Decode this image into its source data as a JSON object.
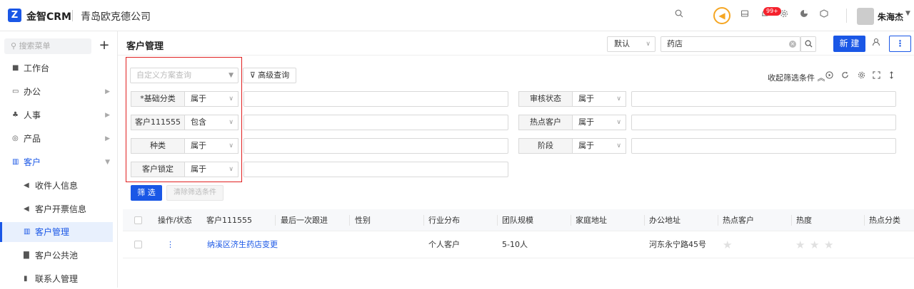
{
  "topbar": {
    "logo_letter": "Z",
    "brand": "金智CRM",
    "company": "青岛欧克德公司",
    "icons": [
      "search-icon",
      "megaphone-icon",
      "inbox-icon",
      "bell-icon",
      "gear-icon",
      "pie-chart-icon",
      "cube-icon"
    ],
    "notification_badge": "99+",
    "username": "朱海杰"
  },
  "sidebar": {
    "search_placeholder": "搜索菜单",
    "add_glyph": "+",
    "items": [
      {
        "label": "工作台",
        "icon": "dashboard-icon",
        "has_arrow": false
      },
      {
        "label": "办公",
        "icon": "monitor-icon",
        "has_arrow": true
      },
      {
        "label": "人事",
        "icon": "org-icon",
        "has_arrow": true
      },
      {
        "label": "产品",
        "icon": "product-icon",
        "has_arrow": true
      },
      {
        "label": "客户",
        "icon": "chart-icon",
        "has_arrow": true,
        "open": true
      }
    ],
    "sub_items": [
      {
        "label": "收件人信息",
        "icon": "speaker-icon"
      },
      {
        "label": "客户开票信息",
        "icon": "speaker-icon"
      },
      {
        "label": "客户管理",
        "icon": "chart-icon",
        "active": true
      },
      {
        "label": "客户公共池",
        "icon": "building-icon"
      },
      {
        "label": "联系人管理",
        "icon": "contact-icon"
      }
    ]
  },
  "header": {
    "title": "客户管理",
    "view_select": "默认",
    "search_value": "药店",
    "new_button": "新 建",
    "more_glyph": "⋮"
  },
  "filter": {
    "scheme_placeholder": "自定义方案查询",
    "advanced_button": "高级查询",
    "collapse_link": "收起筛选条件",
    "rows_left": [
      {
        "label": "*基础分类",
        "op": "属于"
      },
      {
        "label": "客户111555",
        "op": "包含"
      },
      {
        "label": "种类",
        "op": "属于"
      },
      {
        "label": "客户锁定",
        "op": "属于"
      }
    ],
    "rows_right": [
      {
        "label": "审核状态",
        "op": "属于"
      },
      {
        "label": "热点客户",
        "op": "属于"
      },
      {
        "label": "阶段",
        "op": "属于"
      }
    ],
    "filter_button": "筛 选",
    "clear_button": "清除筛选条件"
  },
  "table": {
    "columns": [
      "操作/状态",
      "客户111555",
      "最后一次跟进",
      "性别",
      "行业分布",
      "团队规模",
      "家庭地址",
      "办公地址",
      "热点客户",
      "热度",
      "热点分类"
    ],
    "rows": [
      {
        "action": "⋮",
        "customer": "纳溪区济生药店变更",
        "last_follow": "",
        "gender": "",
        "industry": "个人客户",
        "team_size": "5-10人",
        "home_address": "",
        "office_address": "河东永宁路45号",
        "hot_customer_stars": 1,
        "heat_stars": 3,
        "hot_category": ""
      }
    ]
  },
  "colors": {
    "primary": "#1a57e6",
    "highlight_border": "#e02020",
    "badge": "#f5222d",
    "accent_ring": "#f5a623"
  }
}
